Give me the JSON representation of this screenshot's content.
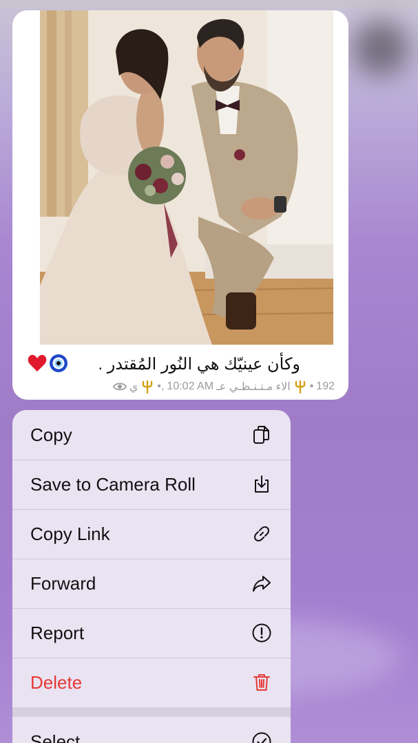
{
  "message": {
    "caption": "وكأن عينيّك هي النُور المُقتدر .",
    "caption_emojis": [
      "nazar-amulet-icon",
      "red-heart-icon"
    ],
    "views": "192",
    "channel_name": "الاء مـتـنـظـي عـ",
    "time": "10:02 AM",
    "meta_suffix": "ي",
    "view_icon": "eye-icon",
    "trident_icon": "trident-emoji-icon"
  },
  "menu": {
    "items": [
      {
        "label": "Copy",
        "icon": "copy-icon"
      },
      {
        "label": "Save to Camera Roll",
        "icon": "download-icon"
      },
      {
        "label": "Copy Link",
        "icon": "link-icon"
      },
      {
        "label": "Forward",
        "icon": "forward-icon"
      },
      {
        "label": "Report",
        "icon": "report-icon"
      },
      {
        "label": "Delete",
        "icon": "trash-icon"
      }
    ],
    "select": {
      "label": "Select",
      "icon": "checkmark-circle-icon"
    }
  },
  "colors": {
    "danger": "#e53935",
    "menu_background": "#ebe6f3",
    "chat_background": "#a57fd0"
  }
}
